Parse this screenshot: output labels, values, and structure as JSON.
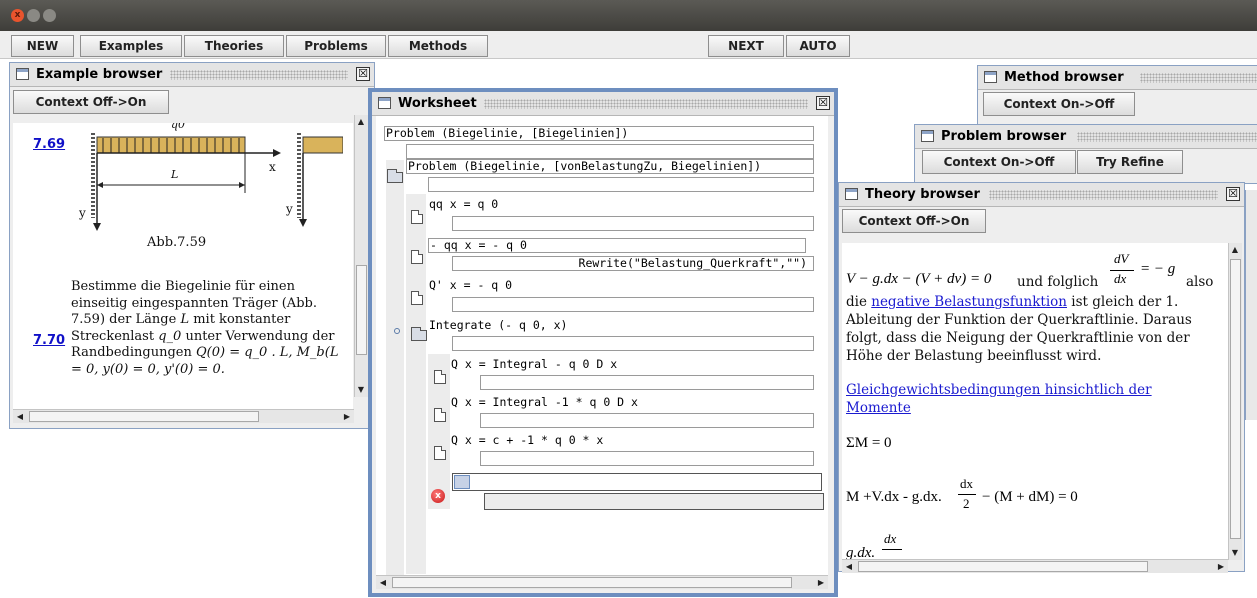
{
  "window": {
    "close_glyph": "x"
  },
  "toolbar": {
    "new": "NEW",
    "examples": "Examples",
    "theories": "Theories",
    "problems": "Problems",
    "methods": "Methods",
    "next": "NEXT",
    "auto": "AUTO"
  },
  "example_browser": {
    "title": "Example browser",
    "close_glyph": "☒",
    "context_button": "Context Off->On",
    "items": [
      {
        "id": "7.69",
        "figure_caption": "Abb.7.59",
        "figure_labels": {
          "load": "q0",
          "length": "L",
          "x_axis": "x",
          "y_axis": "y"
        }
      },
      {
        "id": "7.70",
        "text": "Bestimme die Biegelinie für einen einseitig eingespannten Träger (Abb. 7.59) der Länge",
        "text_l": "L",
        "text_2": "mit konstanter Streckenlast",
        "text_q0": "q_0",
        "text_3": "unter Verwendung der Randbedingungen",
        "text_cond": "Q(0) = q_0 . L, M_b(L = 0, y(0) = 0, y'(0) = 0."
      }
    ]
  },
  "method_browser": {
    "title": "Method browser",
    "context_button": "Context On->Off"
  },
  "problem_browser": {
    "title": "Problem browser",
    "context_button": "Context On->Off",
    "refine_button": "Try Refine"
  },
  "worksheet": {
    "title": "Worksheet",
    "close_glyph": "☒",
    "nodes": [
      {
        "formula": "Problem (Biegelinie, [Biegelinien])"
      },
      {
        "formula": "Problem (Biegelinie, [vonBelastungZu, Biegelinien])"
      },
      {
        "formula": "qq x = q 0"
      },
      {
        "formula": "- qq x = - q 0",
        "rule": "Rewrite(\"Belastung_Querkraft\",\"\")"
      },
      {
        "formula": "Q' x = - q 0"
      },
      {
        "formula": "Integrate (- q 0, x)"
      },
      {
        "formula": "Q x = Integral - q 0 D x"
      },
      {
        "formula": "Q x = Integral -1 * q 0 D x"
      },
      {
        "formula": "Q x = c + -1 * q 0 * x"
      }
    ],
    "error_glyph": "x"
  },
  "theory_browser": {
    "title": "Theory browser",
    "close_glyph": "☒",
    "context_button": "Context Off->On",
    "eq1_left": "V − g.dx − (V + dv) = 0",
    "eq1_mid": "und folglich",
    "eq1_frac_num": "dV",
    "eq1_frac_den": "dx",
    "eq1_right": "= − g",
    "eq1_end": "also",
    "text_pre": "die",
    "link_neg": "negative Belastungsfunktion",
    "text_post": "ist gleich der 1. Ableitung der Funktion der Querkraftlinie. Daraus folgt, dass die Neigung der Querkraftlinie von der Höhe der Belastung beeinflusst wird.",
    "link_gleich": "Gleichgewichtsbedingungen hinsichtlich der Momente",
    "eq2": "ΣM = 0",
    "eq3_left": "M +V.dx - g.dx.",
    "eq3_frac_num": "dx",
    "eq3_frac_den": "2",
    "eq3_right": "− (M + dM) = 0",
    "eq4_left": "g.dx.",
    "eq4_frac_num": "dx"
  }
}
